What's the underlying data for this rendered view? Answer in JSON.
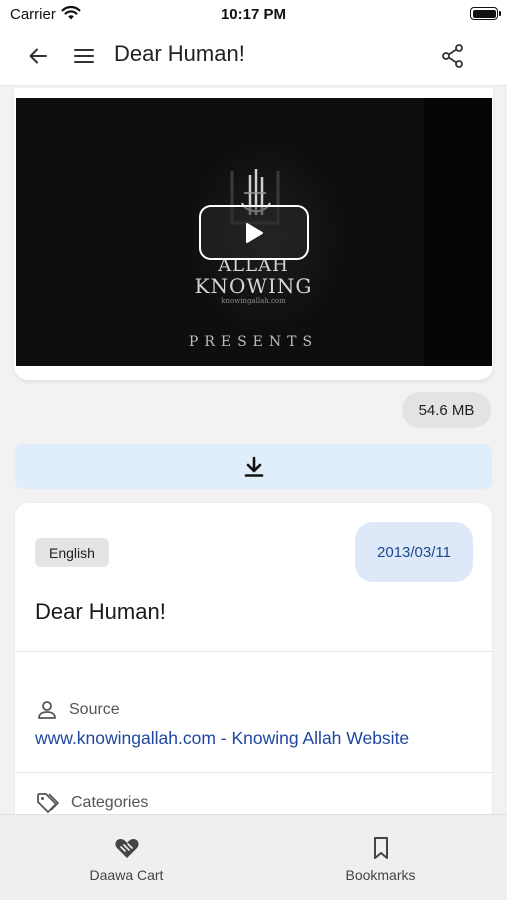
{
  "status": {
    "carrier": "Carrier",
    "time": "10:17 PM"
  },
  "appbar": {
    "title": "Dear Human!"
  },
  "video": {
    "brand_line1": "ALLAH",
    "brand_line2": "KNOWING",
    "brand_url": "knowingallah.com",
    "presents": "PRESENTS"
  },
  "file": {
    "size": "54.6 MB"
  },
  "item": {
    "language": "English",
    "date": "2013/03/11",
    "title": "Dear Human!",
    "source_label": "Source",
    "source_link": "www.knowingallah.com - Knowing Allah Website",
    "categories_label": "Categories"
  },
  "nav": {
    "cart": "Daawa Cart",
    "bookmarks": "Bookmarks"
  },
  "colors": {
    "accent": "#1f47a0",
    "date_chip_bg": "#dde9f9",
    "download_bg": "#e0edfb"
  },
  "icons": [
    "wifi-icon",
    "battery-icon",
    "back-arrow-icon",
    "menu-icon",
    "share-icon",
    "play-icon",
    "download-icon",
    "person-icon",
    "tag-icon",
    "heart-hands-icon",
    "bookmark-icon"
  ]
}
